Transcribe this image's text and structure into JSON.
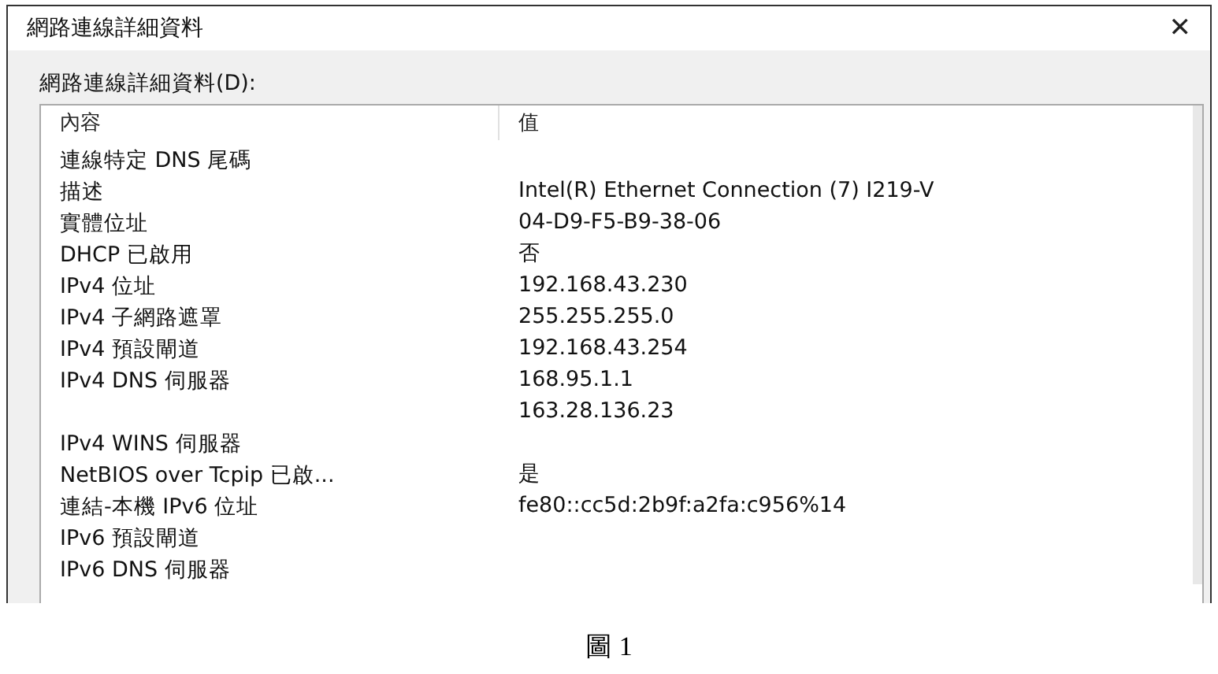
{
  "window": {
    "title": "網路連線詳細資料",
    "close": "✕"
  },
  "list_label": "網路連線詳細資料(D):",
  "table": {
    "columns": [
      "內容",
      "值"
    ],
    "rows": [
      {
        "property": "連線特定 DNS 尾碼",
        "value": ""
      },
      {
        "property": "描述",
        "value": "Intel(R) Ethernet Connection (7) I219-V"
      },
      {
        "property": "實體位址",
        "value": "04-D9-F5-B9-38-06"
      },
      {
        "property": "DHCP 已啟用",
        "value": "否"
      },
      {
        "property": "IPv4 位址",
        "value": "192.168.43.230"
      },
      {
        "property": "IPv4 子網路遮罩",
        "value": "255.255.255.0"
      },
      {
        "property": "IPv4 預設閘道",
        "value": "192.168.43.254"
      },
      {
        "property": "IPv4 DNS 伺服器",
        "value": "168.95.1.1"
      },
      {
        "property": "",
        "value": "163.28.136.23"
      },
      {
        "property": "IPv4 WINS 伺服器",
        "value": ""
      },
      {
        "property": "NetBIOS over Tcpip 已啟...",
        "value": "是"
      },
      {
        "property": "連結-本機 IPv6 位址",
        "value": "fe80::cc5d:2b9f:a2fa:c956%14"
      },
      {
        "property": "IPv6 預設閘道",
        "value": ""
      },
      {
        "property": "IPv6 DNS 伺服器",
        "value": ""
      }
    ]
  },
  "caption": "圖 1"
}
